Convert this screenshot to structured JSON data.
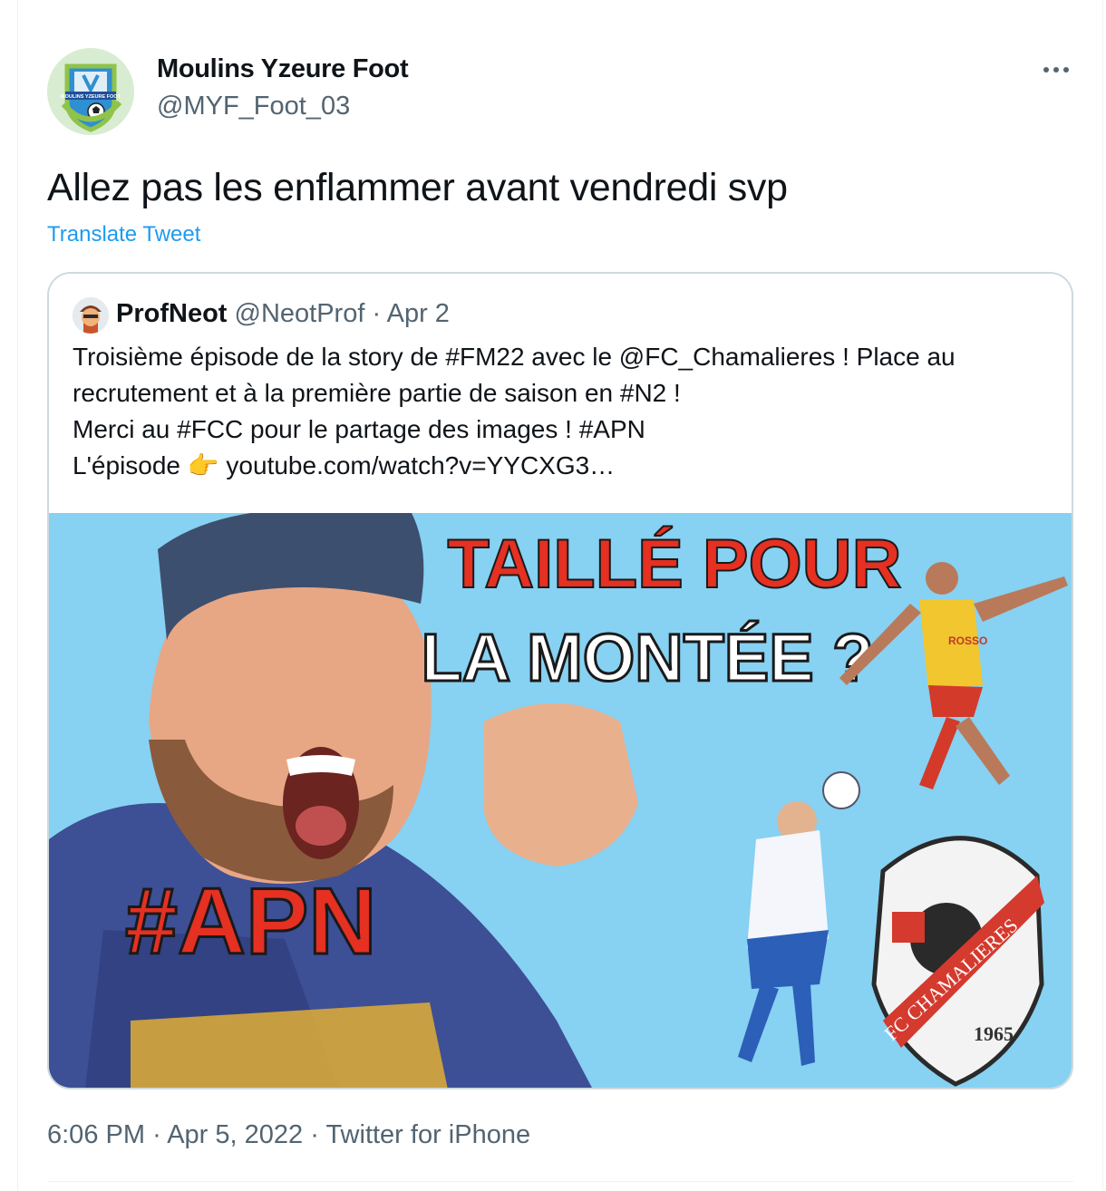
{
  "author": {
    "name": "Moulins Yzeure Foot",
    "handle": "@MYF_Foot_03",
    "avatar_text": "MOULINS YZEURE FOOT"
  },
  "tweet": {
    "text": "Allez pas les enflammer avant vendredi svp",
    "translate_label": "Translate Tweet"
  },
  "quoted": {
    "name": "ProfNeot",
    "handle": "@NeotProf",
    "separator": "·",
    "date": "Apr 2",
    "lines": [
      "Troisième épisode de la story de #FM22 avec le @FC_Chamalieres ! Place au",
      "recrutement et à la première partie de saison en #N2 !",
      "Merci au #FCC pour le partage des images ! #APN",
      "L'épisode 👉 youtube.com/watch?v=YYCXG3…"
    ],
    "media": {
      "headline_line1": "TAILLÉ POUR",
      "headline_line2": "LA MONTÉE ?",
      "hashtag": "#APN",
      "badge_name": "FC CHAMALIERES",
      "badge_year": "1965",
      "jersey_text": "ROSSO",
      "background_color": "#87d1f2",
      "headline_color": "#e53022"
    }
  },
  "footer": {
    "time": "6:06 PM",
    "sep1": "·",
    "date": "Apr 5, 2022",
    "sep2": "·",
    "source": "Twitter for iPhone"
  },
  "colors": {
    "link": "#1d9bf0",
    "muted": "#536471",
    "border": "#cfd9de"
  }
}
